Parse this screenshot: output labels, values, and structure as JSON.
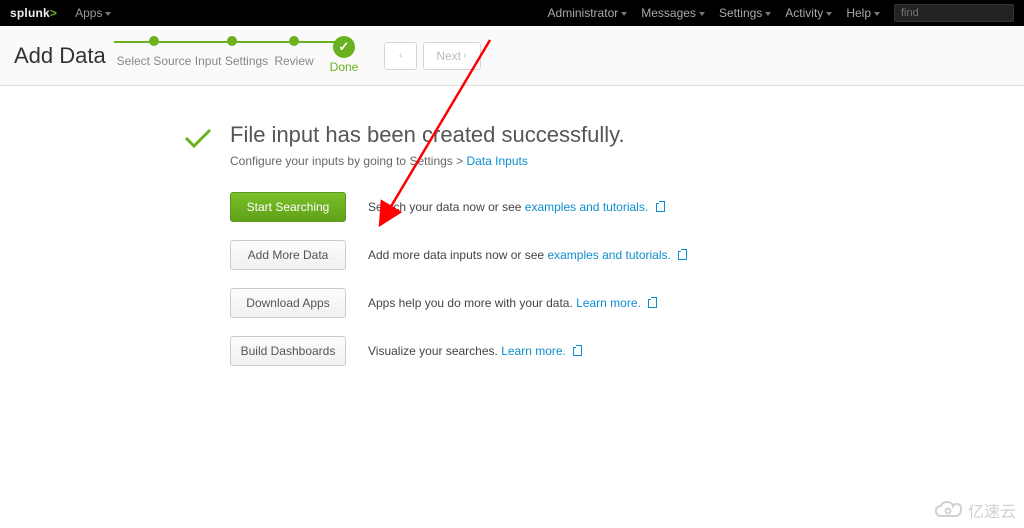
{
  "topbar": {
    "brand_prefix": "splunk",
    "brand_suffix": ">",
    "apps_label": "Apps",
    "menus": {
      "admin": "Administrator",
      "messages": "Messages",
      "settings": "Settings",
      "activity": "Activity",
      "help": "Help"
    },
    "search_placeholder": "find"
  },
  "header": {
    "page_title": "Add Data",
    "wizard": {
      "step1": "Select Source",
      "step2": "Input Settings",
      "step3": "Review",
      "step4": "Done"
    },
    "back_label": "",
    "next_label": "Next"
  },
  "main": {
    "headline": "File input has been created successfully.",
    "subline_prefix": "Configure your inputs by going to Settings > ",
    "subline_link": "Data Inputs",
    "actions": [
      {
        "button": "Start Searching",
        "desc_prefix": "Search your data now or see ",
        "link": "examples and tutorials.",
        "desc_suffix": ""
      },
      {
        "button": "Add More Data",
        "desc_prefix": "Add more data inputs now or see ",
        "link": "examples and tutorials.",
        "desc_suffix": ""
      },
      {
        "button": "Download Apps",
        "desc_prefix": "Apps help you do more with your data. ",
        "link": "Learn more.",
        "desc_suffix": ""
      },
      {
        "button": "Build Dashboards",
        "desc_prefix": "Visualize your searches. ",
        "link": "Learn more.",
        "desc_suffix": ""
      }
    ]
  },
  "watermark": {
    "text": "亿速云"
  }
}
